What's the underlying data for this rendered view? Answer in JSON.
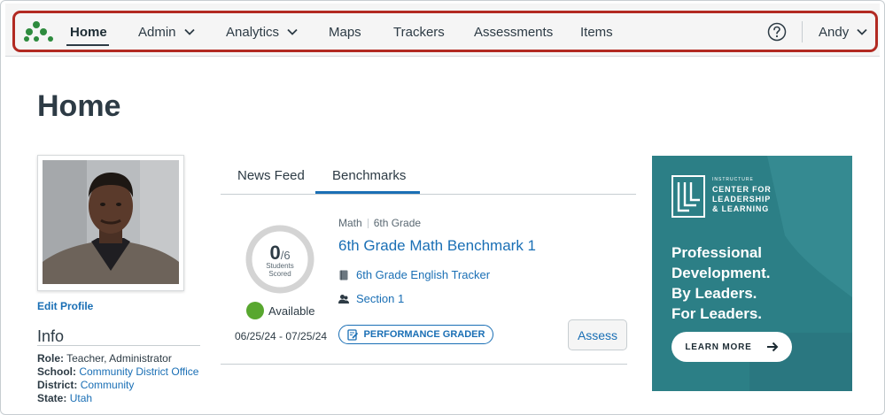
{
  "nav": {
    "items": [
      {
        "label": "Home",
        "active": true
      },
      {
        "label": "Admin",
        "dropdown": true
      },
      {
        "label": "Analytics",
        "dropdown": true
      },
      {
        "label": "Maps"
      },
      {
        "label": "Trackers"
      },
      {
        "label": "Assessments"
      },
      {
        "label": "Items"
      }
    ],
    "user": "Andy"
  },
  "page": {
    "title": "Home"
  },
  "profile": {
    "edit_label": "Edit Profile",
    "info_heading": "Info",
    "role_label": "Role:",
    "role_value": "Teacher, Administrator",
    "school_label": "School:",
    "school_value": "Community District Office",
    "district_label": "District:",
    "district_value": "Community",
    "state_label": "State:",
    "state_value": "Utah"
  },
  "tabs": {
    "news_feed": "News Feed",
    "benchmarks": "Benchmarks"
  },
  "benchmark": {
    "scored": "0",
    "total": "/6",
    "scored_label_1": "Students",
    "scored_label_2": "Scored",
    "status": "Available",
    "dates": "06/25/24 - 07/25/24",
    "subject": "Math",
    "grade": "6th Grade",
    "title": "6th Grade Math Benchmark 1",
    "tracker": "6th Grade English Tracker",
    "section": "Section 1",
    "grader_button": "PERFORMANCE GRADER",
    "assess_button": "Assess"
  },
  "ad": {
    "brand_small": "INSTRUCTURE",
    "brand_line1": "CENTER FOR",
    "brand_line2": "LEADERSHIP",
    "brand_line3": "& LEARNING",
    "headline_1": "Professional",
    "headline_2": "Development.",
    "headline_3": "By Leaders.",
    "headline_4": "For Leaders.",
    "cta": "LEARN MORE"
  },
  "colors": {
    "accent": "#1a6fb5",
    "brand_green": "#2e8b3e",
    "available": "#58a72f",
    "outline": "#b22a22",
    "ad_bg": "#2c7f86"
  }
}
